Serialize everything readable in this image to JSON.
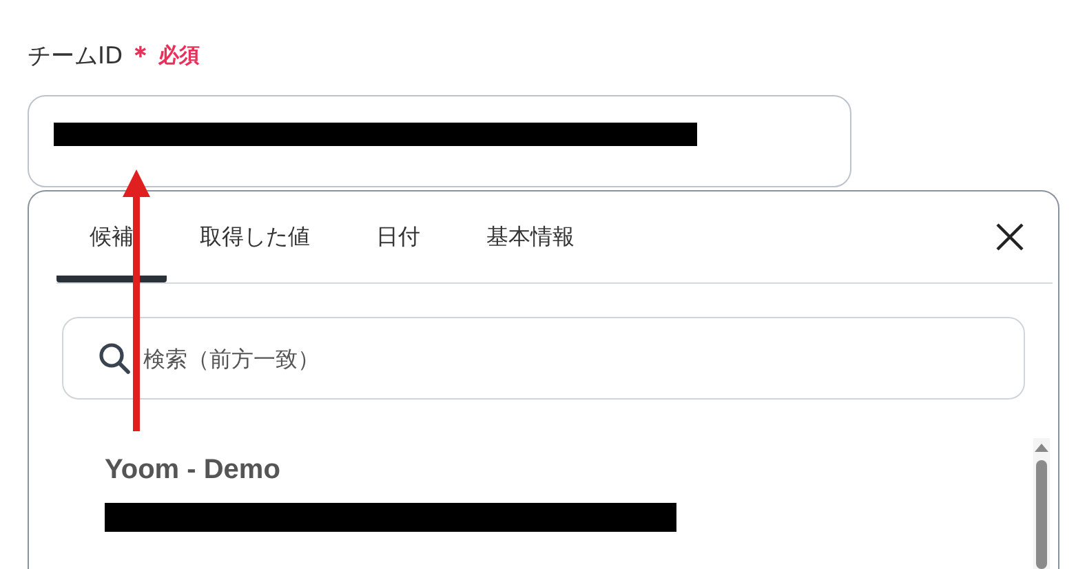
{
  "field": {
    "label": "チームID",
    "required_mark": "＊",
    "required_text": "必須"
  },
  "picker": {
    "tabs": [
      {
        "label": "候補",
        "selected": true
      },
      {
        "label": "取得した値",
        "selected": false
      },
      {
        "label": "日付",
        "selected": false
      },
      {
        "label": "基本情報",
        "selected": false
      }
    ],
    "search": {
      "placeholder": "検索（前方一致）"
    },
    "items": [
      {
        "title": "Yoom - Demo"
      }
    ]
  }
}
